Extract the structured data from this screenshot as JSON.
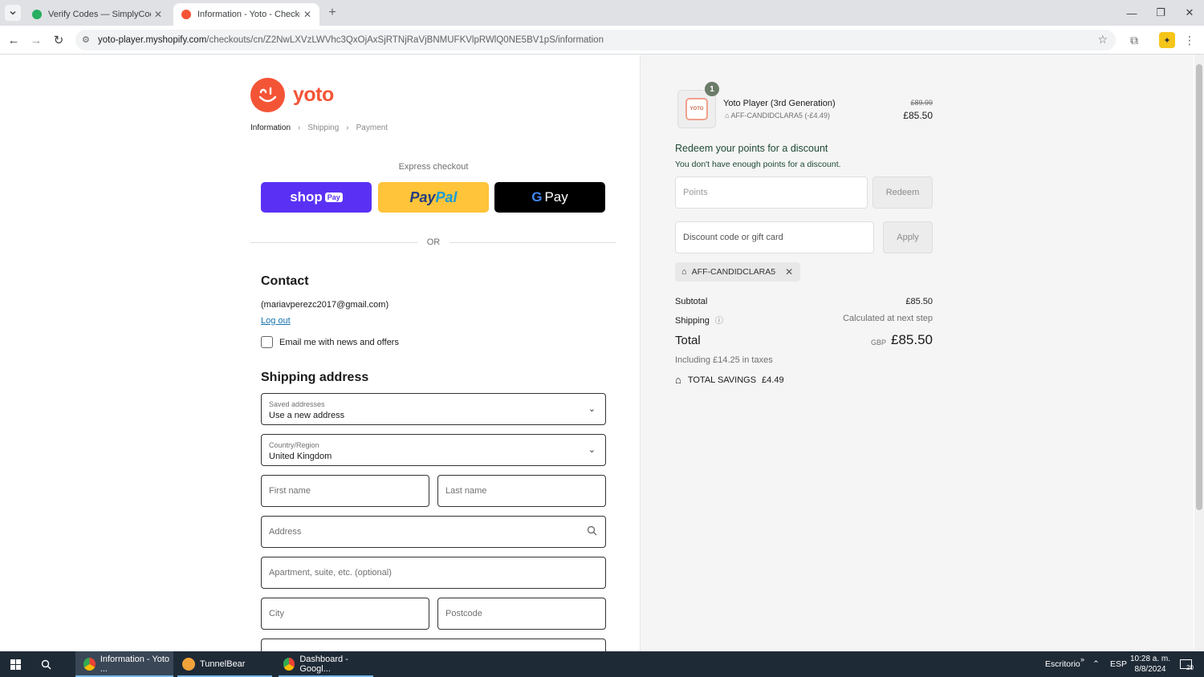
{
  "browser": {
    "tabs": [
      {
        "title": "Verify Codes — SimplyCodes",
        "active": false
      },
      {
        "title": "Information - Yoto - Checkout",
        "active": true
      }
    ],
    "url_host": "yoto-player.myshopify.com",
    "url_path": "/checkouts/cn/Z2NwLXVzLWVhc3QxOjAxSjRTNjRaVjBNMUFKVlpRWlQ0NE5BV1pS/information"
  },
  "store": {
    "logo_text": "yoto"
  },
  "breadcrumb": {
    "information": "Information",
    "shipping": "Shipping",
    "payment": "Payment"
  },
  "express": {
    "label": "Express checkout",
    "shop_pay": "shop",
    "shop_pay_badge": "Pay",
    "paypal_a": "Pay",
    "paypal_b": "Pal",
    "gpay_g": "G",
    "gpay": "Pay",
    "or": "OR"
  },
  "contact": {
    "heading": "Contact",
    "email": "(mariavperezc2017@gmail.com)",
    "logout": "Log out",
    "newsletter": "Email me with news and offers"
  },
  "shipping": {
    "heading": "Shipping address",
    "saved_label": "Saved addresses",
    "saved_value": "Use a new address",
    "country_label": "Country/Region",
    "country_value": "United Kingdom",
    "first_name": "First name",
    "last_name": "Last name",
    "address": "Address",
    "apartment": "Apartment, suite, etc. (optional)",
    "city": "City",
    "postcode": "Postcode"
  },
  "summary": {
    "qty": "1",
    "thumb_text": "YOTO",
    "product": "Yoto Player (3rd Generation)",
    "product_discount": "AFF-CANDIDCLARA5 (-£4.49)",
    "price_old": "£89.99",
    "price_new": "£85.50",
    "redeem_title": "Redeem your points for a discount",
    "redeem_sub": "You don't have enough points for a discount.",
    "points_placeholder": "Points",
    "redeem_button": "Redeem",
    "discount_placeholder": "Discount code or gift card",
    "apply_button": "Apply",
    "applied_code": "AFF-CANDIDCLARA5",
    "subtotal_label": "Subtotal",
    "subtotal": "£85.50",
    "shipping_label": "Shipping",
    "shipping_value": "Calculated at next step",
    "total_label": "Total",
    "currency": "GBP",
    "total": "£85.50",
    "taxes": "Including £14.25 in taxes",
    "savings_label": "TOTAL SAVINGS",
    "savings": "£4.49"
  },
  "taskbar": {
    "apps": [
      "Information - Yoto ...",
      "TunnelBear",
      "Dashboard - Googl..."
    ],
    "desktop": "Escritorio",
    "lang": "ESP",
    "time": "10:28 a. m.",
    "date": "8/8/2024",
    "notif": "20"
  },
  "colors": {
    "brand": "#f45436",
    "shop_pay": "#5a31f4",
    "paypal": "#ffc439",
    "link": "#1773b0"
  }
}
